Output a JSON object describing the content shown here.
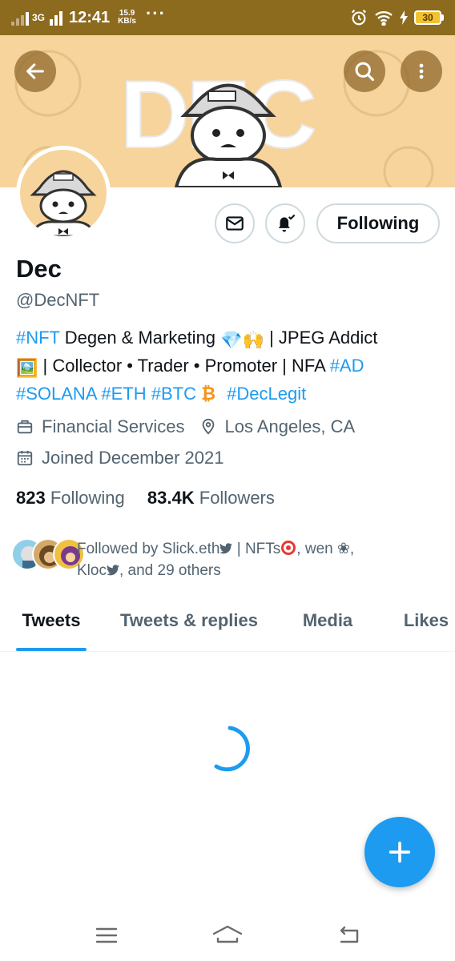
{
  "status_bar": {
    "network": "3G",
    "time": "12:41",
    "speed_value": "15.9",
    "speed_unit": "KB/s",
    "more": "···",
    "battery": "30"
  },
  "banner": {
    "text": "DEC",
    "bg_color": "#f6d49c"
  },
  "profile": {
    "name": "Dec",
    "handle": "@DecNFT",
    "follow_label": "Following",
    "bio": {
      "line1": [
        {
          "text": "#NFT",
          "tag": true
        },
        {
          "text": " Degen & Marketing ",
          "tag": false
        }
      ],
      "line1_emoji": "💎🙌",
      "line1_end": " | JPEG Addict",
      "line2_emoji": "🖼️",
      "line2_text": " | Collector • Trader • Promoter | NFA ",
      "line2_tag": "#AD",
      "line3_tags": "#SOLANA #ETH #BTC",
      "line3_emoji": "₿",
      "line3_tag2": "#DecLegit"
    },
    "category": "Financial Services",
    "location": "Los Angeles, CA",
    "joined": "Joined December 2021",
    "following_count": "823",
    "following_label": "Following",
    "followers_count": "83.4K",
    "followers_label": "Followers",
    "followed_by": {
      "line1": "Followed by Slick.eth",
      "line1_mid": " | NFTs",
      "line1_end": ", wen ❀,",
      "line2_a": "Kloc",
      "line2_b": ", and 29 others"
    }
  },
  "tabs": [
    {
      "label": "Tweets",
      "active": true
    },
    {
      "label": "Tweets & replies",
      "active": false
    },
    {
      "label": "Media",
      "active": false
    },
    {
      "label": "Likes",
      "active": false
    }
  ],
  "colors": {
    "accent": "#1d9bf0",
    "status_bar": "#8c6a1e"
  },
  "icons": [
    "back-arrow-icon",
    "search-icon",
    "more-vertical-icon",
    "mail-icon",
    "bell-icon",
    "briefcase-icon",
    "location-pin-icon",
    "calendar-icon",
    "compose-plus-icon",
    "menu-icon",
    "home-icon",
    "back-icon"
  ]
}
